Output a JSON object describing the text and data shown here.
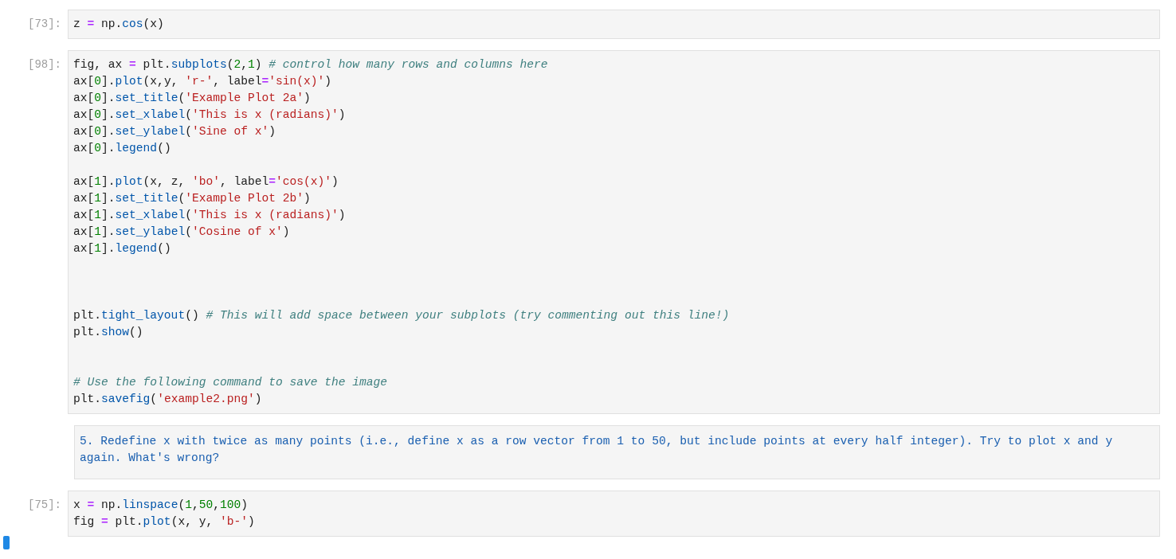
{
  "cells": [
    {
      "kind": "code",
      "prompt": "[73]:",
      "source": "z = np.cos(x)"
    },
    {
      "kind": "code",
      "prompt": "[98]:",
      "source": "fig, ax = plt.subplots(2,1) # control how many rows and columns here\nax[0].plot(x,y, 'r-', label='sin(x)')\nax[0].set_title('Example Plot 2a')\nax[0].set_xlabel('This is x (radians)')\nax[0].set_ylabel('Sine of x')\nax[0].legend()\n\nax[1].plot(x, z, 'bo', label='cos(x)')\nax[1].set_title('Example Plot 2b')\nax[1].set_xlabel('This is x (radians)')\nax[1].set_ylabel('Cosine of x')\nax[1].legend()\n\n\n\nplt.tight_layout() # This will add space between your subplots (try commenting out this line!)\nplt.show()\n\n\n# Use the following command to save the image\nplt.savefig('example2.png')"
    },
    {
      "kind": "markdown",
      "text": "5. Redefine x with twice as many points (i.e., define x as a row vector from 1 to 50, but include points at every half integer). Try to plot x and y again. What's wrong?"
    },
    {
      "kind": "code",
      "prompt": "[75]:",
      "source": "x = np.linspace(1,50,100)\nfig = plt.plot(x, y, 'b-')"
    }
  ]
}
